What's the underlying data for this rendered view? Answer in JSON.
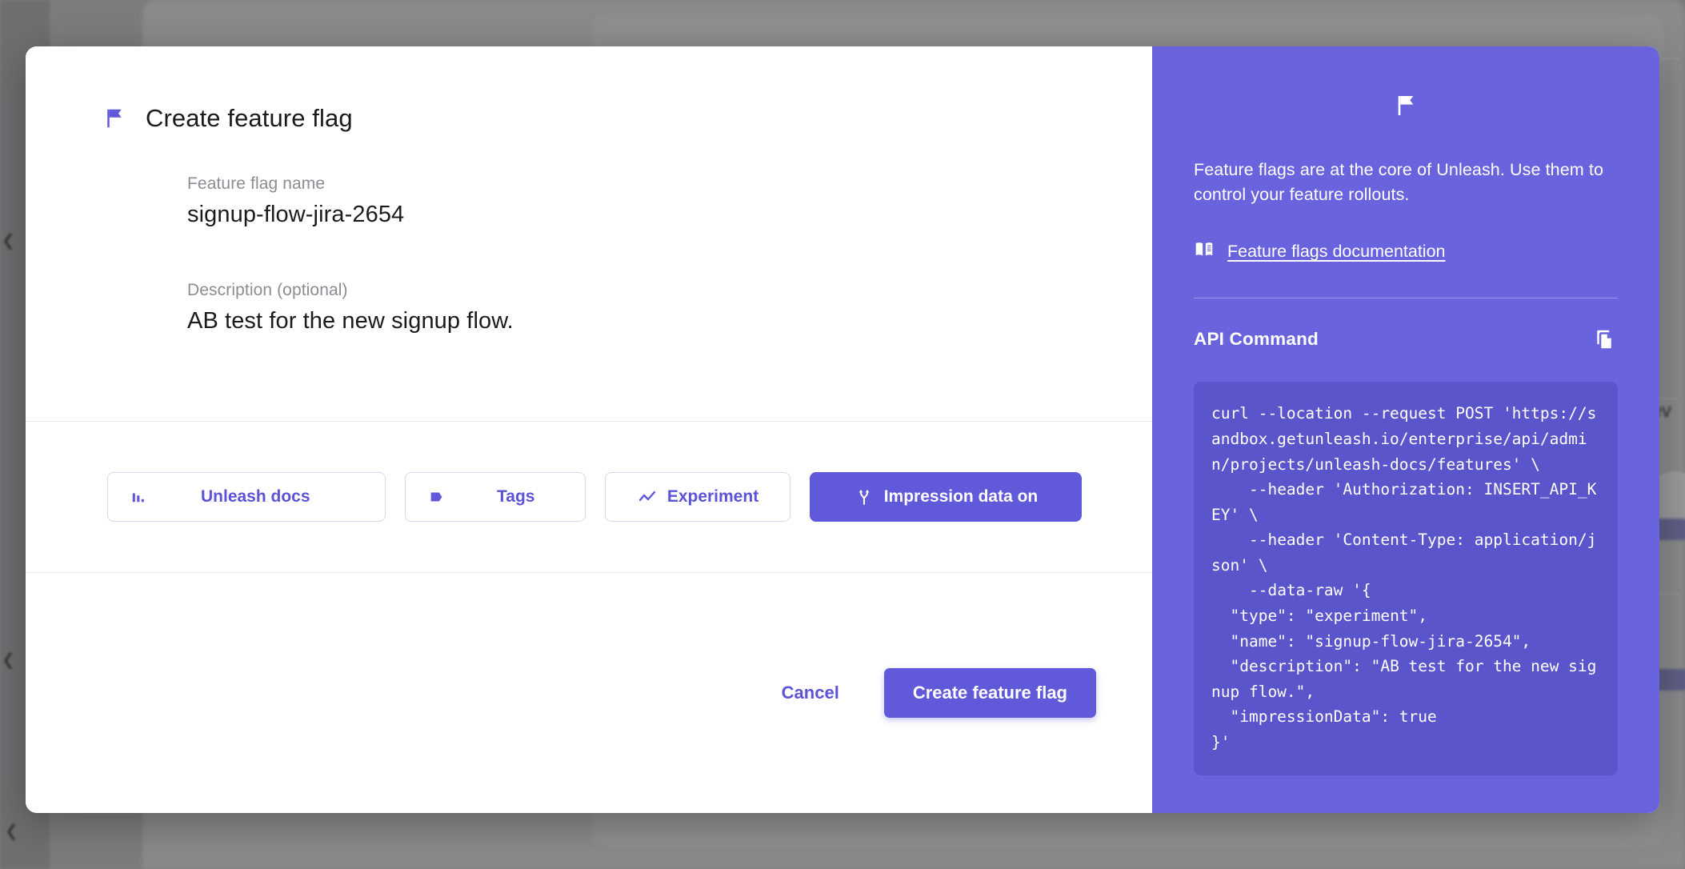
{
  "modal": {
    "title": "Create feature flag",
    "flag_icon": "flag-icon",
    "fields": [
      {
        "label": "Feature flag name",
        "value": "signup-flow-jira-2654"
      },
      {
        "label": "Description (optional)",
        "value": "AB test for the new signup flow."
      }
    ],
    "options": [
      {
        "id": "unleash-docs",
        "label": "Unleash docs",
        "icon": "bar-chart-icon",
        "active": false
      },
      {
        "id": "tags",
        "label": "Tags",
        "icon": "tag-icon",
        "active": false
      },
      {
        "id": "experiment",
        "label": "Experiment",
        "icon": "trending-up-icon",
        "active": false
      },
      {
        "id": "impression-data",
        "label": "Impression data on",
        "icon": "call-split-icon",
        "active": true
      }
    ],
    "footer": {
      "cancel_label": "Cancel",
      "submit_label": "Create feature flag"
    }
  },
  "sidepanel": {
    "flag_icon": "flag-icon",
    "intro": "Feature flags are at the core of Unleash. Use them to control your feature rollouts.",
    "doc_icon": "book-icon",
    "doc_link_label": "Feature flags documentation",
    "api_title": "API Command",
    "copy_icon": "copy-icon",
    "code": "curl --location --request POST 'https://sandbox.getunleash.io/enterprise/api/admin/projects/unleash-docs/features' \\\n    --header 'Authorization: INSERT_API_KEY' \\\n    --header 'Content-Type: application/json' \\\n    --data-raw '{\n  \"type\": \"experiment\",\n  \"name\": \"signup-flow-jira-2654\",\n  \"description\": \"AB test for the new signup flow.\",\n  \"impressionData\": true\n}'"
  },
  "background": {
    "visible_text": "dev"
  },
  "colors": {
    "accent": "#6059da",
    "panel": "#6a63de",
    "code_bg": "#5b55cb",
    "link": "#5c53d8",
    "label": "#8c8c93"
  }
}
